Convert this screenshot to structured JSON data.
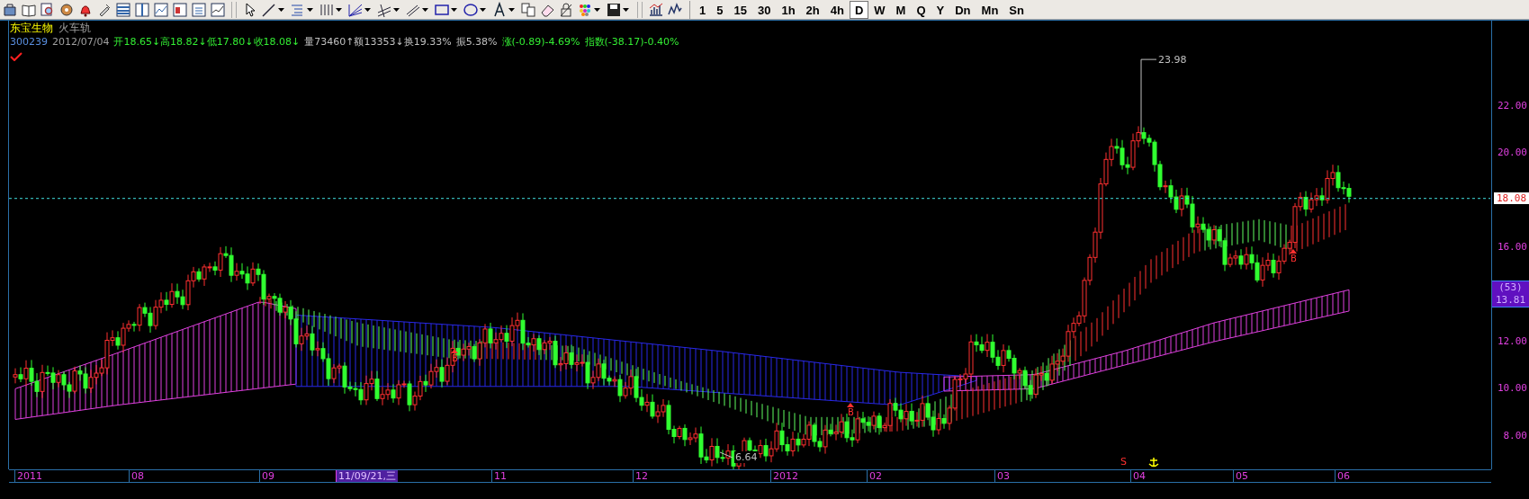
{
  "toolbar": {
    "periods": [
      {
        "label": "1",
        "selected": false
      },
      {
        "label": "5",
        "selected": false
      },
      {
        "label": "15",
        "selected": false
      },
      {
        "label": "30",
        "selected": false
      },
      {
        "label": "1h",
        "selected": false
      },
      {
        "label": "2h",
        "selected": false
      },
      {
        "label": "4h",
        "selected": false
      },
      {
        "label": "D",
        "selected": true
      },
      {
        "label": "W",
        "selected": false
      },
      {
        "label": "M",
        "selected": false
      },
      {
        "label": "Q",
        "selected": false
      },
      {
        "label": "Y",
        "selected": false
      },
      {
        "label": "Dn",
        "selected": false
      },
      {
        "label": "Mn",
        "selected": false
      },
      {
        "label": "Sn",
        "selected": false
      }
    ]
  },
  "stock": {
    "name": "东宝生物",
    "indicator": "火车轨"
  },
  "quote": [
    {
      "text": "300239",
      "color": "#5a8fe0"
    },
    {
      "text": "2012/07/04",
      "color": "#a0a0a0"
    },
    {
      "text": "开18.65↓高18.82↓低17.80↓收18.08↓",
      "color": "#33ee33"
    },
    {
      "text": "量73460↑额13353↓换19.33%",
      "color": "#c0c0c0"
    },
    {
      "text": "振5.38%",
      "color": "#c0c0c0"
    },
    {
      "text": "涨(-0.89)-4.69%",
      "color": "#33ee33"
    },
    {
      "text": "指数(-38.17)-0.40%",
      "color": "#33ee33"
    }
  ],
  "chart": {
    "high_label": "23.98",
    "low_label": "6.64",
    "markers": [
      {
        "label": "B"
      },
      {
        "label": "B"
      },
      {
        "label": "B"
      }
    ],
    "sell_marker": "S",
    "y_ticks": [
      "22.00",
      "20.00",
      "16.00",
      "12.00",
      "10.00",
      "8.00"
    ],
    "price_tag": "18.08",
    "cursor_tag": {
      "count": "(53)",
      "price": "13.81"
    }
  },
  "x_axis": [
    {
      "label": "2011",
      "selected": false
    },
    {
      "label": "08",
      "selected": false
    },
    {
      "label": "09",
      "selected": false
    },
    {
      "label": "11/09/21,三",
      "selected": true
    },
    {
      "label": "11",
      "selected": false
    },
    {
      "label": "12",
      "selected": false
    },
    {
      "label": "2012",
      "selected": false
    },
    {
      "label": "02",
      "selected": false
    },
    {
      "label": "03",
      "selected": false
    },
    {
      "label": "04",
      "selected": false
    },
    {
      "label": "05",
      "selected": false
    },
    {
      "label": "06",
      "selected": false
    }
  ]
}
